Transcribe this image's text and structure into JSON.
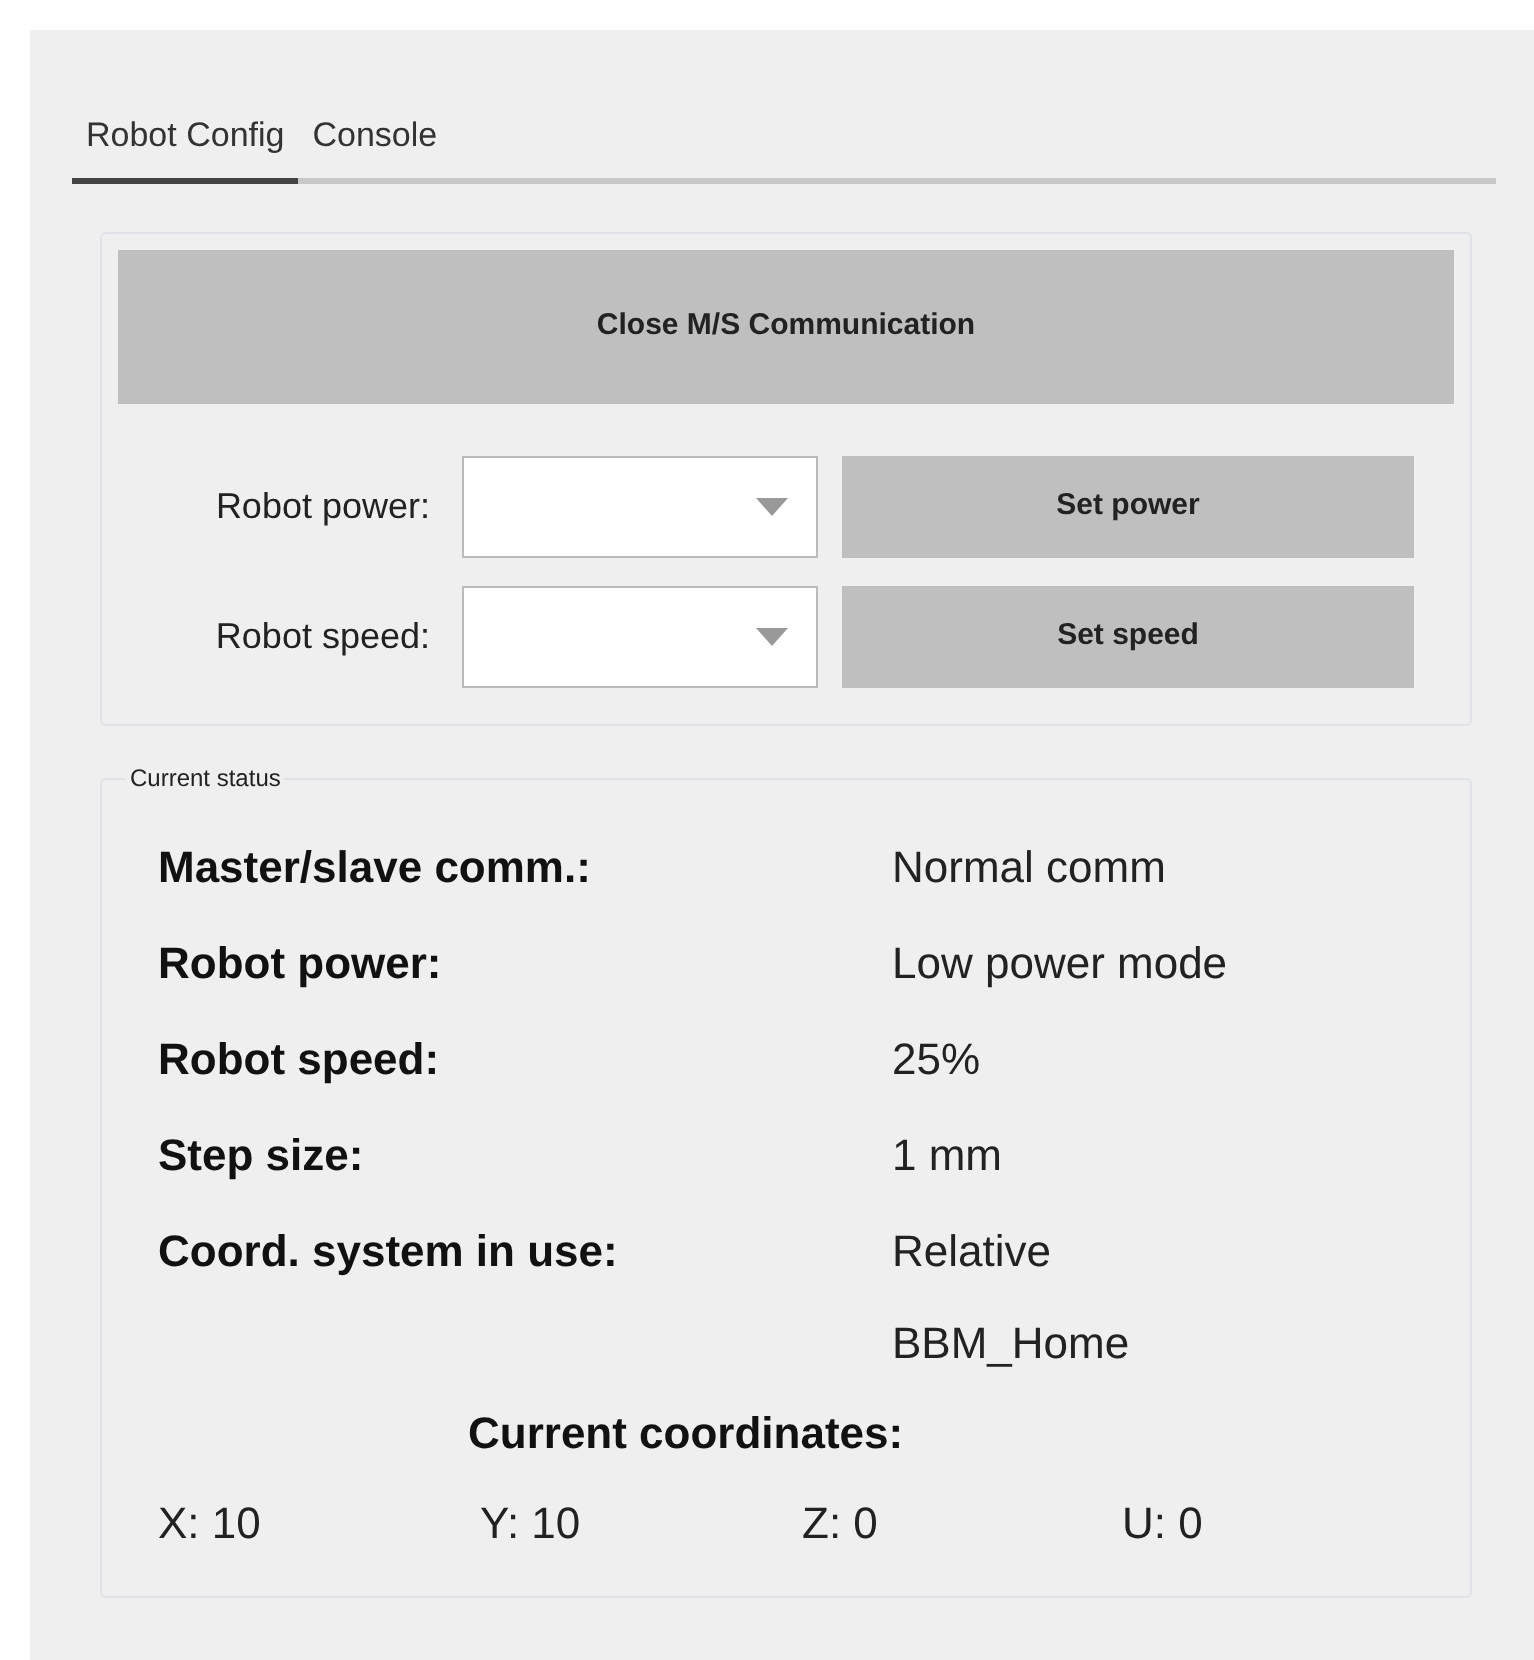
{
  "tabs": [
    {
      "label": "Robot Config",
      "selected": true
    },
    {
      "label": "Console",
      "selected": false
    }
  ],
  "controls": {
    "close_button": "Close M/S Communication",
    "rows": [
      {
        "label": "Robot power:",
        "button": "Set power"
      },
      {
        "label": "Robot speed:",
        "button": "Set speed"
      }
    ]
  },
  "status": {
    "title": "Current status",
    "rows": [
      {
        "label": "Master/slave comm.:",
        "values": [
          "Normal comm"
        ]
      },
      {
        "label": "Robot power:",
        "values": [
          "Low power mode"
        ]
      },
      {
        "label": "Robot speed:",
        "values": [
          "25%"
        ]
      },
      {
        "label": "Step size:",
        "values": [
          "1 mm"
        ]
      },
      {
        "label": "Coord. system in use:",
        "values": [
          "Relative",
          "BBM_Home"
        ]
      }
    ],
    "coordinates_title": "Current coordinates:",
    "coordinates": [
      "X: 10",
      "Y: 10",
      "Z: 0",
      "U: 0"
    ]
  }
}
